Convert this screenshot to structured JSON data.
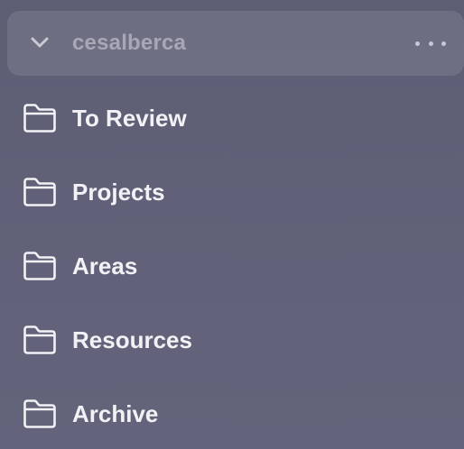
{
  "account": {
    "name": "cesalberca",
    "expand_icon": "chevron-down-icon",
    "more_icon": "ellipsis-icon"
  },
  "folders": [
    {
      "label": "To Review",
      "icon": "folder-icon"
    },
    {
      "label": "Projects",
      "icon": "folder-icon"
    },
    {
      "label": "Areas",
      "icon": "folder-icon"
    },
    {
      "label": "Resources",
      "icon": "folder-icon"
    },
    {
      "label": "Archive",
      "icon": "folder-icon"
    }
  ],
  "colors": {
    "background": "#5f6076",
    "header_background": "rgba(255,255,255,0.10)",
    "header_text": "#a7a7b6",
    "item_text": "#f2f2f6",
    "icon_stroke": "#f2f2f6"
  }
}
